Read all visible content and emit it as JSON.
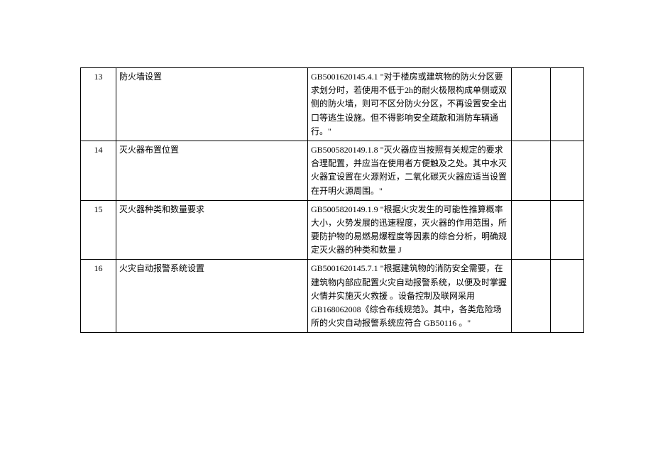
{
  "rows": [
    {
      "num": "13",
      "item": "防火墙设置",
      "spec": "GB5001620145.4.1 \"对于楼房或建筑物的防火分区要求划分时，若使用不低于2h的耐火极限构成单侧或双侧的防火墙，则可不区分防火分区，不再设置安全出口等逃生设施。但不得影响安全疏散和消防车辆通行。\""
    },
    {
      "num": "14",
      "item": "灭火器布置位置",
      "spec": "GB5005820149.1.8 \"灭火器应当按照有关规定的要求合理配置，并应当在使用者方便触及之处。其中水灭火器宜设置在火源附近，二氧化碳灭火器应适当设置在开明火源周围。\""
    },
    {
      "num": "15",
      "item": "灭火器种类和数量要求",
      "spec": "GB5005820149.1.9 \"根据火灾发生的可能性推算概率大小，火势发展的迅速程度，灭火器的作用范围，所要防护物的易燃易爆程度等因素的综合分析，明确规定灭火器的种类和数量 J"
    },
    {
      "num": "16",
      "item": "火灾自动报警系统设置",
      "spec": "GB5001620145.7.1 \"根据建筑物的消防安全需要，在建筑物内部应配置火灾自动报警系统，以便及时掌握火情并实施灭火救援 。设备控制及联网采用GB168062008《综合布线规范》。其中，各类危险场所的火灾自动报警系统应符合 GB50116 。\""
    }
  ]
}
